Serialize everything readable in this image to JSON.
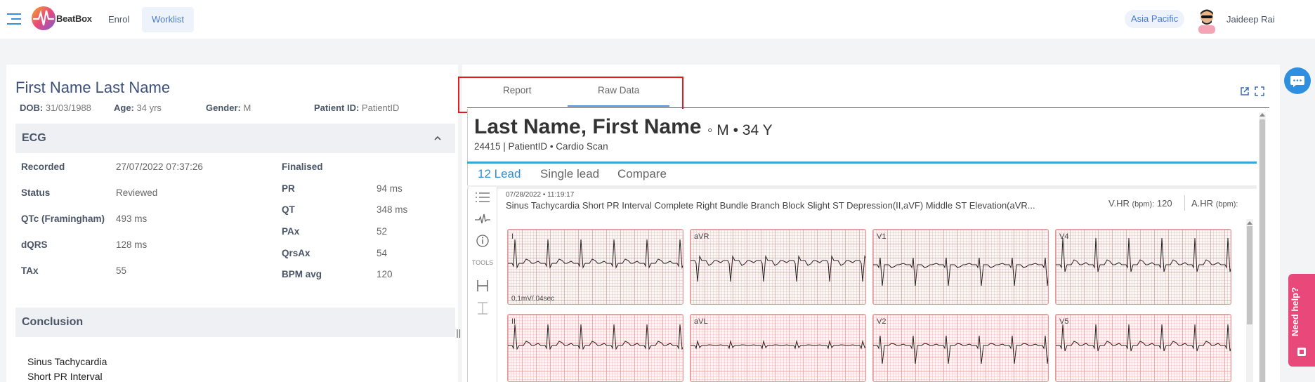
{
  "app": {
    "brand": "BeatBox"
  },
  "nav": {
    "enrol": "Enrol",
    "worklist": "Worklist"
  },
  "header": {
    "region": "Asia Pacific",
    "user_name": "Jaideep Rai"
  },
  "patient": {
    "name": "First Name Last Name",
    "dob_label": "DOB:",
    "dob": "31/03/1988",
    "age_label": "Age:",
    "age": "34 yrs",
    "gender_label": "Gender:",
    "gender": "M",
    "pid_label": "Patient ID:",
    "pid": "PatientID"
  },
  "ecg": {
    "title": "ECG",
    "left": [
      {
        "label": "Recorded",
        "value": "27/07/2022 07:37:26"
      },
      {
        "label": "Status",
        "value": "Reviewed"
      },
      {
        "label": "QTc (Framingham)",
        "value": "493 ms"
      },
      {
        "label": "dQRS",
        "value": "128 ms"
      },
      {
        "label": "TAx",
        "value": "55"
      }
    ],
    "right": [
      {
        "label": "Finalised",
        "value": ""
      },
      {
        "label": "PR",
        "value": "94 ms"
      },
      {
        "label": "QT",
        "value": "348 ms"
      },
      {
        "label": "PAx",
        "value": "52"
      },
      {
        "label": "QrsAx",
        "value": "54"
      },
      {
        "label": "BPM avg",
        "value": "120"
      }
    ]
  },
  "conclusion": {
    "title": "Conclusion",
    "items": [
      "Sinus Tachycardia",
      "Short PR Interval"
    ]
  },
  "tabs": {
    "report": "Report",
    "raw_data": "Raw Data",
    "active": "raw_data"
  },
  "viewer": {
    "name": "Last Name, First Name",
    "meta": "◦ M • 34 Y",
    "sub": "24415 | PatientID • Cardio Scan",
    "tabs": [
      "12 Lead",
      "Single lead",
      "Compare"
    ],
    "tools_label": "TOOLS",
    "timestamp": "07/28/2022 • 11:19:17",
    "diagnosis": "Sinus Tachycardia Short PR Interval Complete Right Bundle Branch Block Slight ST Depression(II,aVF) Middle ST Elevation(aVR...",
    "vhr_label": "V.HR",
    "vhr_unit": "(bpm):",
    "vhr_value": "120",
    "ahr_label": "A.HR",
    "ahr_unit": "(bpm):",
    "scale": "0,1mV/.04sec",
    "leads": [
      "I",
      "aVR",
      "V1",
      "V4",
      "II",
      "aVL",
      "V2",
      "V5"
    ]
  },
  "help": {
    "label": "Need help?"
  }
}
